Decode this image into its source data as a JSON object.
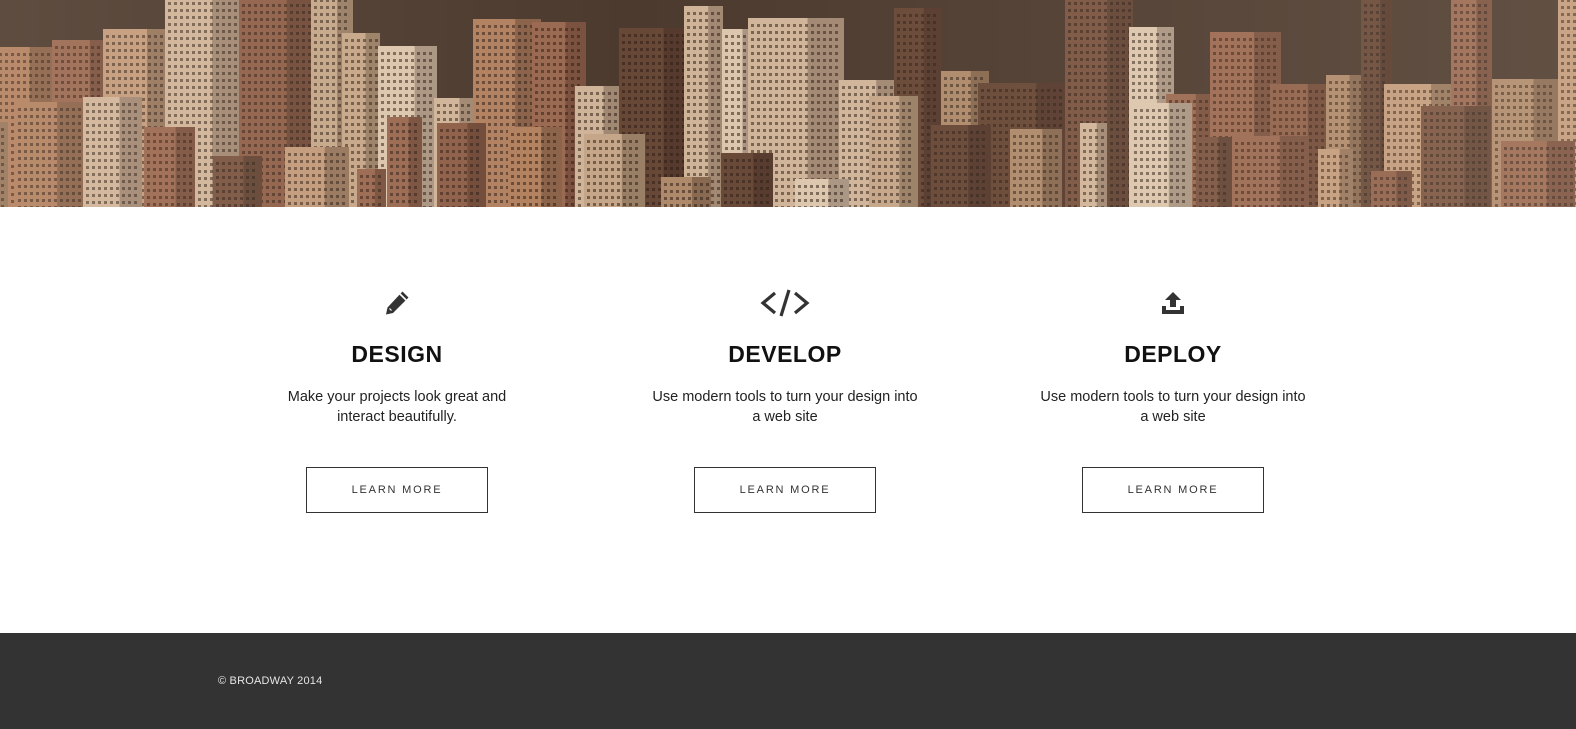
{
  "hero": {
    "image": "city-skyline-photo"
  },
  "features": [
    {
      "icon": "pencil-icon",
      "title": "DESIGN",
      "description_lines": [
        "Make your projects look great and",
        "interact beautifully."
      ],
      "button_label": "LEARN MORE"
    },
    {
      "icon": "code-icon",
      "title": "DEVELOP",
      "description_lines": [
        "Use modern tools to turn your design into",
        "a web site"
      ],
      "button_label": "LEARN MORE"
    },
    {
      "icon": "upload-icon",
      "title": "DEPLOY",
      "description_lines": [
        "Use modern tools to turn your design into",
        "a web site"
      ],
      "button_label": "LEARN MORE"
    }
  ],
  "footer": {
    "copyright": "© BROADWAY 2014"
  },
  "colors": {
    "footer_bg": "#333333",
    "text": "#111111",
    "button_border": "#333333"
  }
}
